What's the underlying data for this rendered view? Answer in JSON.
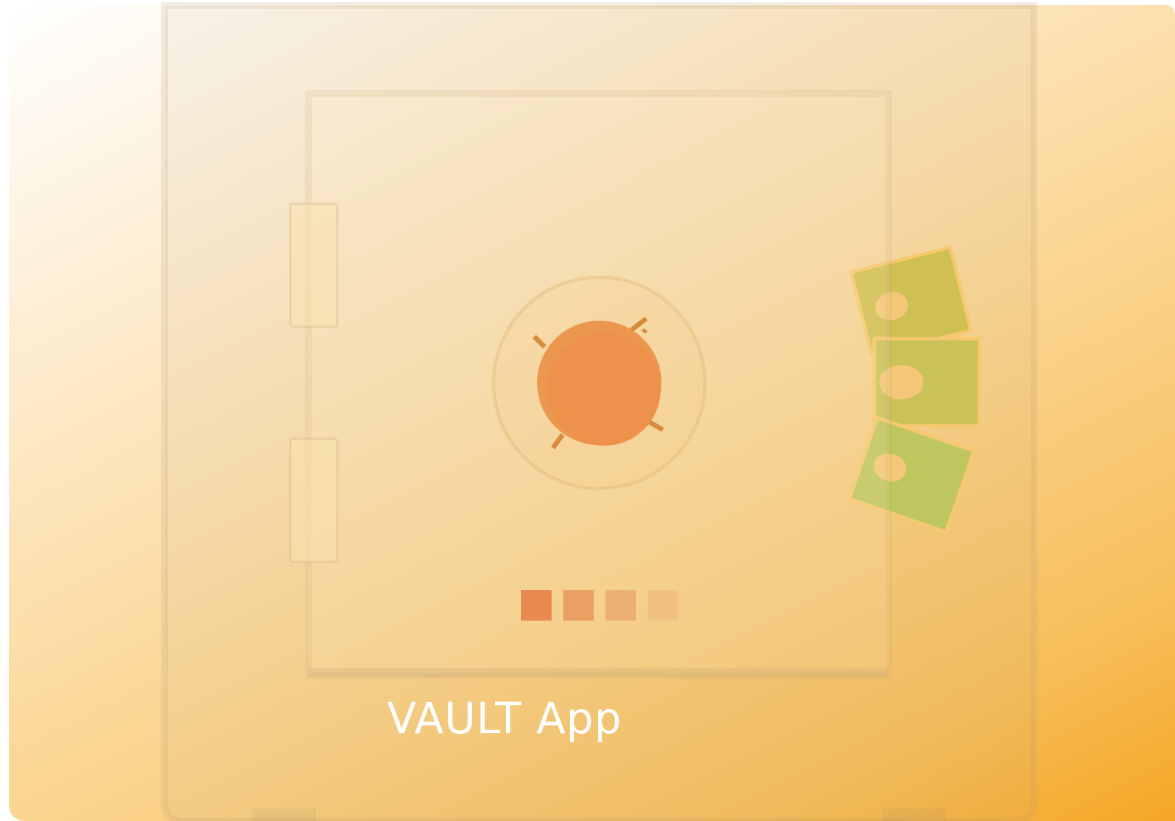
{
  "app": {
    "title": "VAULT App"
  },
  "icons": {
    "safe": "vault-safe-icon",
    "dial": "combination-dial-icon",
    "cash": "cash-bills-icon",
    "hinge": "hinge-icon",
    "keypad": "keypad-indicator-icon"
  },
  "colors": {
    "background_start": "#ffffff",
    "background_end": "#f5a623",
    "dial": "#ec934a",
    "cash": "#c3c65a",
    "keypad_dark": "#e88950",
    "label": "#ffffff"
  }
}
